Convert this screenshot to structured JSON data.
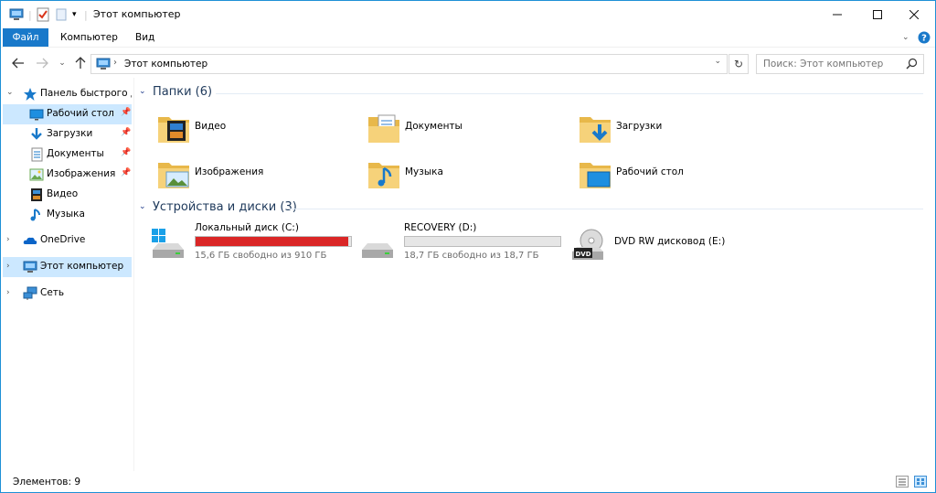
{
  "window": {
    "title": "Этот компьютер",
    "accent": "#1979ca"
  },
  "ribbon": {
    "tabs": [
      "Файл",
      "Компьютер",
      "Вид"
    ]
  },
  "address": {
    "path": "Этот компьютер",
    "search_placeholder": "Поиск: Этот компьютер"
  },
  "sidebar": {
    "items": [
      {
        "label": "Панель быстрого доступа",
        "icon": "star-icon"
      },
      {
        "label": "Рабочий стол",
        "icon": "desktop-icon",
        "pinned": true
      },
      {
        "label": "Загрузки",
        "icon": "download-icon",
        "pinned": true
      },
      {
        "label": "Документы",
        "icon": "documents-icon",
        "pinned": true
      },
      {
        "label": "Изображения",
        "icon": "pictures-icon",
        "pinned": true
      },
      {
        "label": "Видео",
        "icon": "video-icon"
      },
      {
        "label": "Музыка",
        "icon": "music-icon"
      },
      {
        "label": "OneDrive",
        "icon": "cloud-icon"
      },
      {
        "label": "Этот компьютер",
        "icon": "computer-icon"
      },
      {
        "label": "Сеть",
        "icon": "network-icon"
      }
    ]
  },
  "groups": {
    "folders_title": "Папки (6)",
    "devices_title": "Устройства и диски (3)"
  },
  "folders": [
    {
      "label": "Видео",
      "icon": "video-folder-icon"
    },
    {
      "label": "Документы",
      "icon": "documents-folder-icon"
    },
    {
      "label": "Загрузки",
      "icon": "downloads-folder-icon"
    },
    {
      "label": "Изображения",
      "icon": "pictures-folder-icon"
    },
    {
      "label": "Музыка",
      "icon": "music-folder-icon"
    },
    {
      "label": "Рабочий стол",
      "icon": "desktop-folder-icon"
    }
  ],
  "drives": [
    {
      "name": "Локальный диск (C:)",
      "free": "15,6 ГБ свободно из 910 ГБ",
      "used_fraction": 0.983,
      "bar_color": "#da2626",
      "icon": "windows-drive-icon"
    },
    {
      "name": "RECOVERY (D:)",
      "free": "18,7 ГБ свободно из 18,7 ГБ",
      "used_fraction": 0.0,
      "bar_color": "#26a0da",
      "icon": "hard-drive-icon"
    },
    {
      "name": "DVD RW дисковод (E:)",
      "icon": "dvd-drive-icon"
    }
  ],
  "status": {
    "count": "Элементов: 9"
  }
}
